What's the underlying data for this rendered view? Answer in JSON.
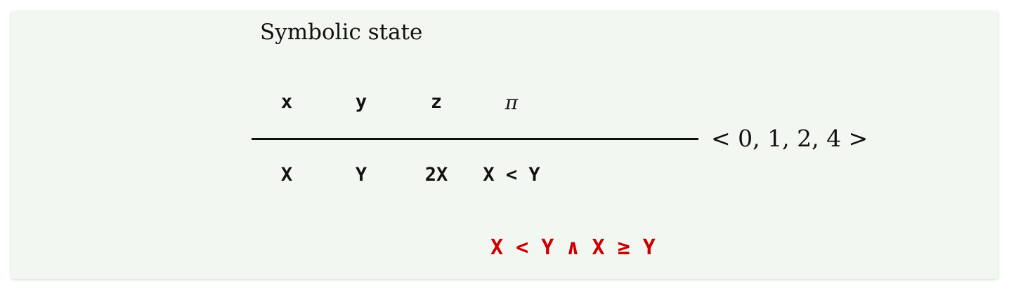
{
  "title": "Symbolic state",
  "variables": [
    "x",
    "y",
    "z",
    "π"
  ],
  "values": [
    "X",
    "Y",
    "2X",
    "X < Y"
  ],
  "concrete_tuple": "< 0, 1, 2, 4 >",
  "conflict_formula": "X < Y ∧ X ≥ Y",
  "colors": {
    "background": "#f2f7f2",
    "text": "#111111",
    "conflict": "#cc0000"
  }
}
